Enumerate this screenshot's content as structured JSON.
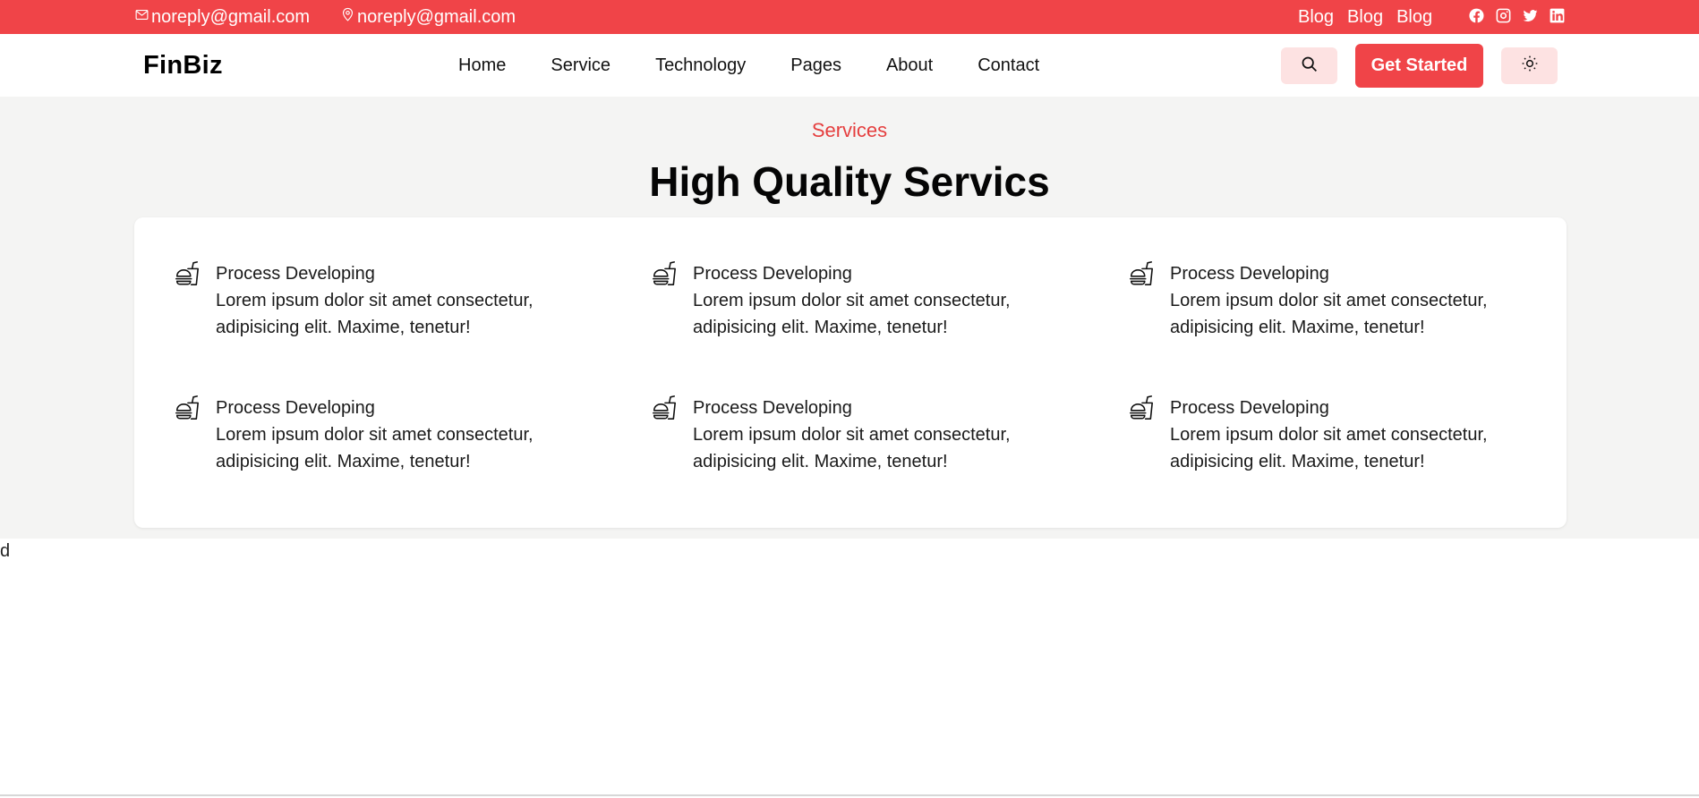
{
  "topbar": {
    "email_1": "noreply@gmail.com",
    "email_2": "noreply@gmail.com",
    "blogs": [
      "Blog",
      "Blog",
      "Blog"
    ],
    "email_icon": "mail-icon",
    "location_icon": "map-pin-icon",
    "socials": [
      "facebook-icon",
      "instagram-icon",
      "twitter-icon",
      "linkedin-icon"
    ],
    "background": "#f04448"
  },
  "navbar": {
    "logo": "FinBiz",
    "links": [
      "Home",
      "Service",
      "Technology",
      "Pages",
      "About",
      "Contact"
    ],
    "search_icon": "search-icon",
    "cta_label": "Get Started",
    "theme_icon": "sun-icon"
  },
  "services": {
    "eyebrow": "Services",
    "title": "High Quality Servics",
    "items": [
      {
        "title": "Process Developing",
        "line1": "Lorem ipsum dolor sit amet consectetur,",
        "line2": "adipisicing elit. Maxime, tenetur!"
      },
      {
        "title": "Process Developing",
        "line1": "Lorem ipsum dolor sit amet consectetur,",
        "line2": "adipisicing elit. Maxime, tenetur!"
      },
      {
        "title": "Process Developing",
        "line1": "Lorem ipsum dolor sit amet consectetur,",
        "line2": "adipisicing elit. Maxime, tenetur!"
      },
      {
        "title": "Process Developing",
        "line1": "Lorem ipsum dolor sit amet consectetur,",
        "line2": "adipisicing elit. Maxime, tenetur!"
      },
      {
        "title": "Process Developing",
        "line1": "Lorem ipsum dolor sit amet consectetur,",
        "line2": "adipisicing elit. Maxime, tenetur!"
      },
      {
        "title": "Process Developing",
        "line1": "Lorem ipsum dolor sit amet consectetur,",
        "line2": "adipisicing elit. Maxime, tenetur!"
      }
    ],
    "item_icon": "fast-food-icon",
    "accent": "#e53e3e"
  },
  "stray_text": "d"
}
